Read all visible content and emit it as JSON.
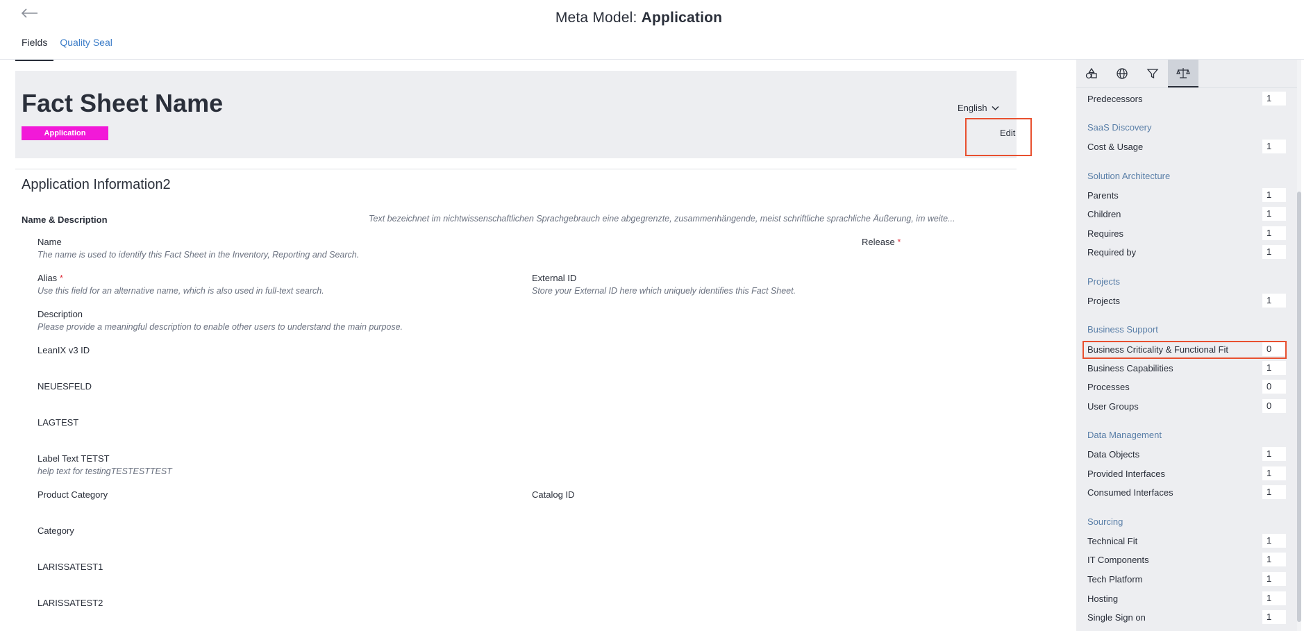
{
  "header": {
    "title_prefix": "Meta Model: ",
    "title_bold": "Application",
    "tabs": [
      {
        "label": "Fields"
      },
      {
        "label": "Quality Seal"
      }
    ]
  },
  "card": {
    "fact_sheet_name": "Fact Sheet Name",
    "type_badge": "Application",
    "language": "English",
    "edit_label": "Edit"
  },
  "section": {
    "title": "Application Information2",
    "name_desc_label": "Name & Description",
    "name_desc_text": "Text bezeichnet im nichtwissenschaftlichen Sprachgebrauch eine abgegrenzte, zusammenhängende, meist schriftliche sprachliche Äußerung, im weite..."
  },
  "fields": [
    {
      "label": "Name",
      "help": "The name is used to identify this Fact Sheet in the Inventory, Reporting and Search."
    },
    {
      "label": "Release"
    },
    {
      "label": "Alias",
      "help": "Use this field for an alternative name, which is also used in full-text search."
    },
    {
      "label": "External ID",
      "help": "Store your External ID here which uniquely identifies this Fact Sheet."
    },
    {
      "label": "Description",
      "help": "Please provide a meaningful description to enable other users to understand the main purpose."
    },
    {
      "label": "LeanIX v3 ID"
    },
    {
      "label": "NEUESFELD"
    },
    {
      "label": "LAGTEST"
    },
    {
      "label": "Label Text TETST",
      "help": "help text for testingTESTESTTEST"
    },
    {
      "label": "Product Category"
    },
    {
      "label": "Catalog ID"
    },
    {
      "label": "Category"
    },
    {
      "label": "LARISSATEST1"
    },
    {
      "label": "LARISSATEST2"
    }
  ],
  "required_mark": "*",
  "sidebar": {
    "icons": [
      "shapes-icon",
      "globe-icon",
      "filter-icon",
      "scale-icon"
    ],
    "groups": [
      {
        "title": "SaaS Discovery"
      },
      {
        "title": "Solution Architecture"
      },
      {
        "title": "Projects"
      },
      {
        "title": "Business Support"
      },
      {
        "title": "Data Management"
      },
      {
        "title": "Sourcing"
      }
    ],
    "rows": [
      {
        "label": "Predecessors",
        "count": "1"
      },
      {
        "label": "Cost & Usage",
        "count": "1"
      },
      {
        "label": "Parents",
        "count": "1"
      },
      {
        "label": "Children",
        "count": "1"
      },
      {
        "label": "Requires",
        "count": "1"
      },
      {
        "label": "Required by",
        "count": "1"
      },
      {
        "label": "Projects",
        "count": "1"
      },
      {
        "label": "Business Criticality & Functional Fit",
        "count": "0"
      },
      {
        "label": "Business Capabilities",
        "count": "1"
      },
      {
        "label": "Processes",
        "count": "0"
      },
      {
        "label": "User Groups",
        "count": "0"
      },
      {
        "label": "Data Objects",
        "count": "1"
      },
      {
        "label": "Provided Interfaces",
        "count": "1"
      },
      {
        "label": "Consumed Interfaces",
        "count": "1"
      },
      {
        "label": "Technical Fit",
        "count": "1"
      },
      {
        "label": "IT Components",
        "count": "1"
      },
      {
        "label": "Tech Platform",
        "count": "1"
      },
      {
        "label": "Hosting",
        "count": "1"
      },
      {
        "label": "Single Sign on",
        "count": "1"
      }
    ]
  },
  "colors": {
    "badge": "#f219d8",
    "highlight": "#e8502f",
    "link": "#3c7dc8",
    "group_title": "#5a7fa8"
  }
}
